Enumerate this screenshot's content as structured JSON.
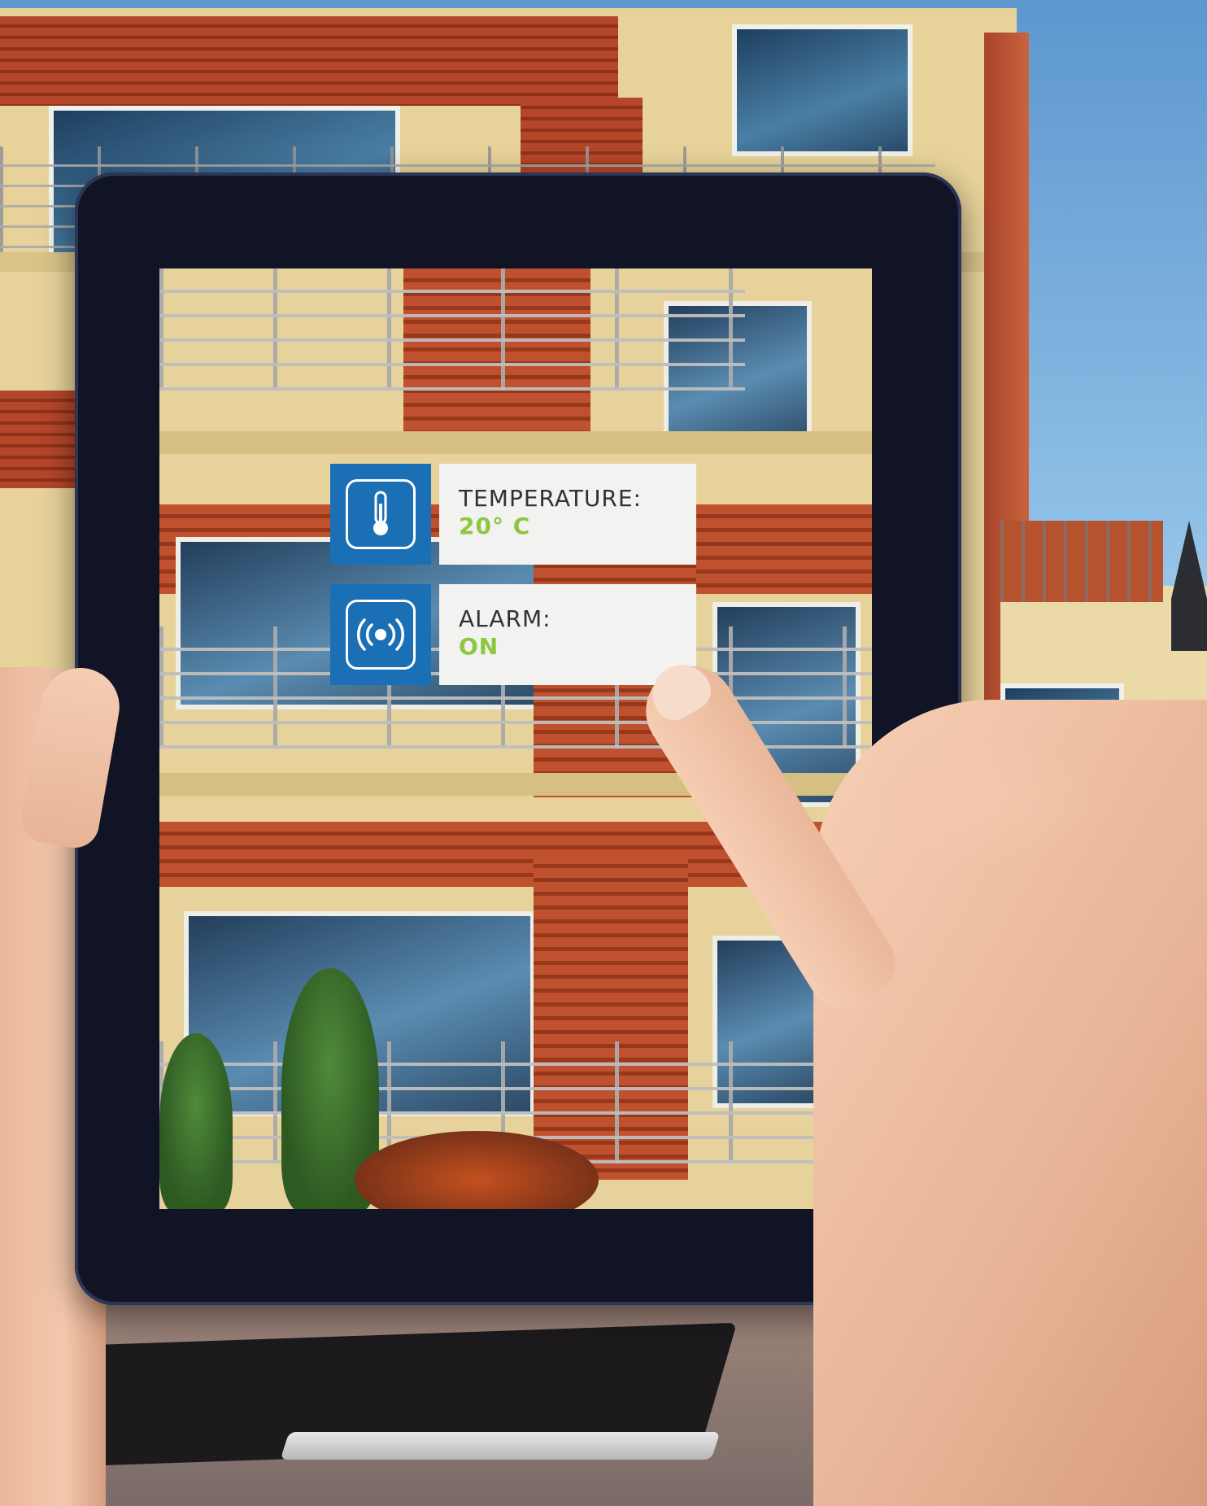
{
  "overlay": {
    "temperature": {
      "label": "TEMPERATURE:",
      "value": "20° C",
      "icon": "thermometer-icon"
    },
    "alarm": {
      "label": "ALARM:",
      "value": "ON",
      "icon": "alarm-broadcast-icon"
    }
  },
  "colors": {
    "tile_blue": "#1b6fb5",
    "value_green": "#8dc63f",
    "card_bg": "#f2f2f1",
    "label_text": "#2f3136",
    "tablet_bezel": "#101424"
  }
}
